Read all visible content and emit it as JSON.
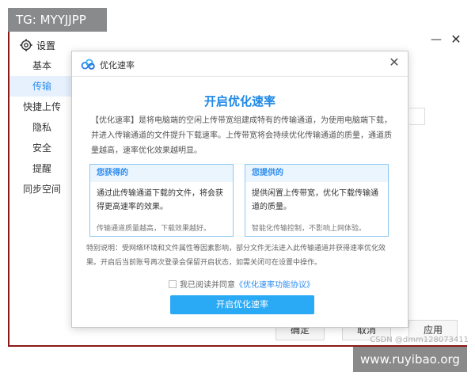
{
  "watermark_tag": "TG: MYYJJPP",
  "site_tag": "www.ruyibao.org",
  "csdn_mark": "CSDN @dmm128073411",
  "settings": {
    "title": "设置",
    "min_glyph": "—",
    "close_glyph": "✕",
    "sidebar": [
      {
        "label": "基本"
      },
      {
        "label": "传输"
      },
      {
        "label": "快捷上传"
      },
      {
        "label": "隐私"
      },
      {
        "label": "安全"
      },
      {
        "label": "提醒"
      },
      {
        "label": "同步空间"
      }
    ],
    "ok_label": "确定",
    "cancel_label": "取消",
    "apply_label": "应用"
  },
  "dialog": {
    "title": "优化速率",
    "close_glyph": "✕",
    "heading": "开启优化速率",
    "description": "【优化速率】是将电脑端的空闲上传带宽组建成特有的传输通道，为使用电脑端下载，并进入传输通道的文件提升下载速率。上传带宽将会持续优化传输通道的质量，通道质量越高，速率优化效果越明显。",
    "cards": [
      {
        "title": "您获得的",
        "body": "通过此传输通道下载的文件，将会获得更高速率的效果。",
        "note": "传输通道质量越高，下载效果越好。"
      },
      {
        "title": "您提供的",
        "body": "提供闲置上传带宽，优化下载传输通道的质量。",
        "note": "智能化传输控制，不影响上网体验。"
      }
    ],
    "notice": "特别说明：受网络环境和文件属性等因素影响，部分文件无法进入此传输通道并获得速率优化效果。开启后当前账号再次登录会保留开启状态，如需关闭可在设置中操作。",
    "agree_text": "我已阅读并同意",
    "agree_link": "《优化速率功能协议》",
    "agree_checked": false,
    "button_label": "开启优化速率"
  }
}
